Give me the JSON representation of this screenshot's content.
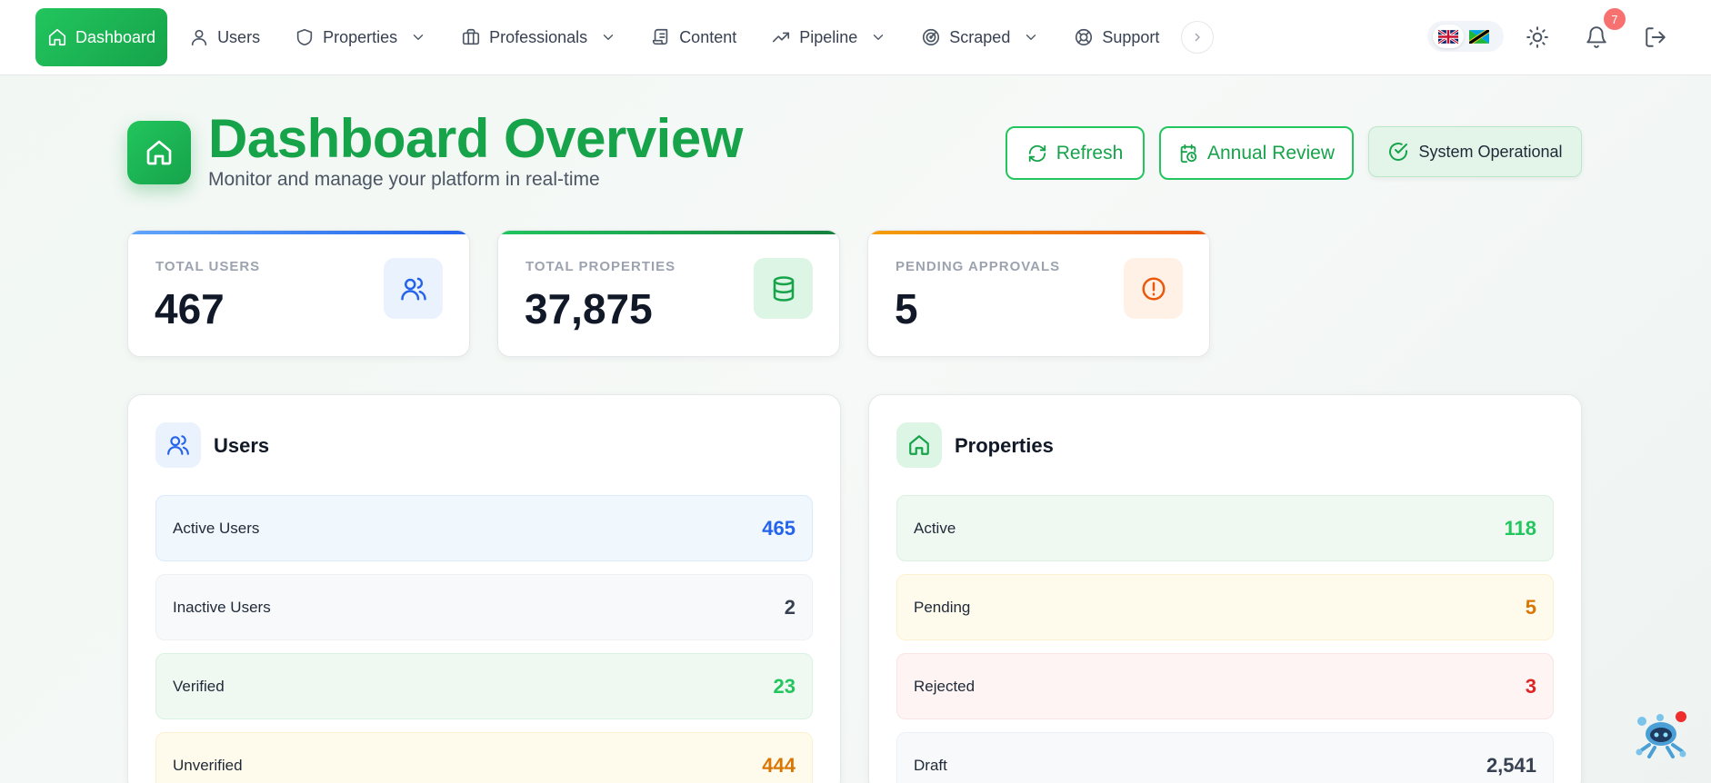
{
  "nav": {
    "items": [
      {
        "label": "Dashboard",
        "icon": "home-icon",
        "active": true
      },
      {
        "label": "Users",
        "icon": "user-icon"
      },
      {
        "label": "Properties",
        "icon": "shield-icon",
        "dropdown": true
      },
      {
        "label": "Professionals",
        "icon": "briefcase-icon",
        "dropdown": true
      },
      {
        "label": "Content",
        "icon": "scroll-icon"
      },
      {
        "label": "Pipeline",
        "icon": "trending-up-icon",
        "dropdown": true
      },
      {
        "label": "Scraped",
        "icon": "radar-icon",
        "dropdown": true
      },
      {
        "label": "Support",
        "icon": "lifebuoy-icon"
      }
    ],
    "notifications_count": "7",
    "languages": [
      "uk-flag",
      "tz-flag"
    ]
  },
  "header": {
    "title": "Dashboard Overview",
    "subtitle": "Monitor and manage your platform in real-time",
    "refresh_label": "Refresh",
    "annual_review_label": "Annual Review",
    "status_label": "System Operational"
  },
  "stats": [
    {
      "label": "TOTAL USERS",
      "value": "467",
      "accent": "#2563eb",
      "icon": "users-icon"
    },
    {
      "label": "TOTAL PROPERTIES",
      "value": "37,875",
      "accent": "#16a34a",
      "icon": "database-icon"
    },
    {
      "label": "PENDING APPROVALS",
      "value": "5",
      "accent": "#ea580c",
      "icon": "alert-circle-icon"
    }
  ],
  "users_panel": {
    "title": "Users",
    "rows": [
      {
        "label": "Active Users",
        "value": "465",
        "color": "#2563eb"
      },
      {
        "label": "Inactive Users",
        "value": "2",
        "color": "#374151"
      },
      {
        "label": "Verified",
        "value": "23",
        "color": "#22c55e"
      },
      {
        "label": "Unverified",
        "value": "444",
        "color": "#d97706"
      }
    ]
  },
  "properties_panel": {
    "title": "Properties",
    "rows": [
      {
        "label": "Active",
        "value": "118",
        "color": "#22c55e"
      },
      {
        "label": "Pending",
        "value": "5",
        "color": "#d97706"
      },
      {
        "label": "Rejected",
        "value": "3",
        "color": "#dc2626"
      },
      {
        "label": "Draft",
        "value": "2,541",
        "color": "#374151"
      }
    ]
  }
}
